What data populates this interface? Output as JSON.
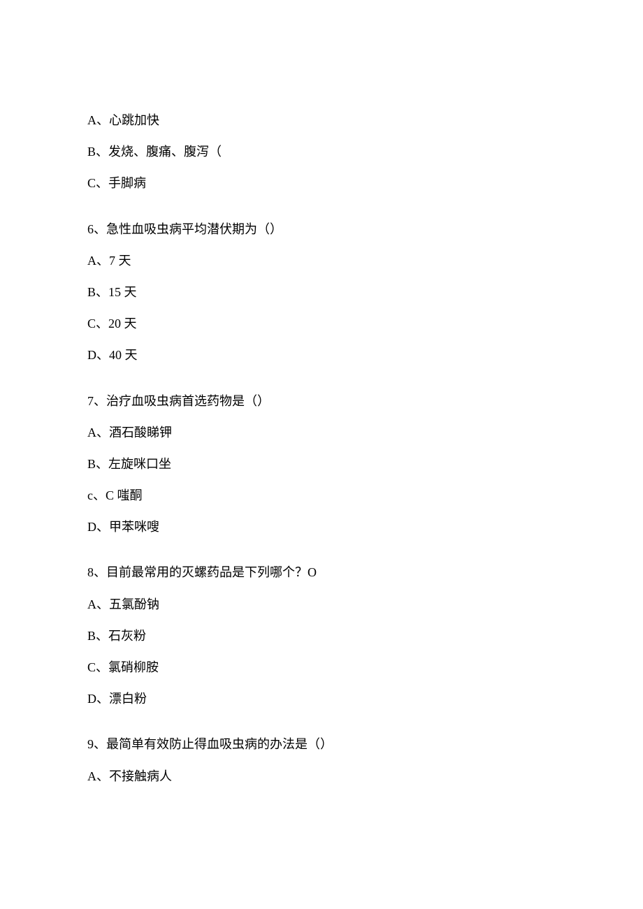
{
  "lines": [
    {
      "text": "A、心跳加快",
      "class": "line"
    },
    {
      "text": "B、发烧、腹痛、腹泻（",
      "class": "line"
    },
    {
      "text": "C、手脚病",
      "class": "line"
    },
    {
      "text": "6、急性血吸虫病平均潜伏期为（）",
      "class": "line question-start"
    },
    {
      "text": "A、7 天",
      "class": "line"
    },
    {
      "text": "B、15 天",
      "class": "line"
    },
    {
      "text": "C、20 天",
      "class": "line"
    },
    {
      "text": "D、40 天",
      "class": "line"
    },
    {
      "text": "7、治疗血吸虫病首选药物是（）",
      "class": "line question-start"
    },
    {
      "text": "A、酒石酸睇钾",
      "class": "line"
    },
    {
      "text": "B、左旋咪口坐",
      "class": "line"
    },
    {
      "text": "c、C 嗤酮",
      "class": "line"
    },
    {
      "text": "D、甲苯咪嗖",
      "class": "line"
    },
    {
      "text": "8、目前最常用的灭螺药品是下列哪个？O",
      "class": "line question-start"
    },
    {
      "text": "A、五氯酚钠",
      "class": "line"
    },
    {
      "text": "B、石灰粉",
      "class": "line"
    },
    {
      "text": "C、氯硝柳胺",
      "class": "line"
    },
    {
      "text": "D、漂白粉",
      "class": "line"
    },
    {
      "text": "9、最简单有效防止得血吸虫病的办法是（）",
      "class": "line question-start"
    },
    {
      "text": "A、不接触病人",
      "class": "line"
    }
  ]
}
